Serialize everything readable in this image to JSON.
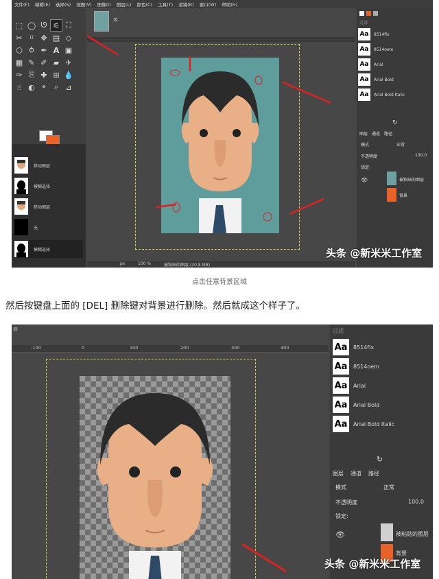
{
  "screenshot1": {
    "menu": [
      "文件(F)",
      "编辑(E)",
      "选择(S)",
      "视图(V)",
      "图像(I)",
      "图层(L)",
      "颜色(C)",
      "工具(T)",
      "滤镜(R)",
      "窗口(W)",
      "帮助(H)"
    ],
    "channels": [
      {
        "label": "移动图层"
      },
      {
        "label": "模糊选择"
      },
      {
        "label": "移动图层"
      },
      {
        "label": "无"
      },
      {
        "label": "模糊选择"
      }
    ],
    "status": {
      "unit": "px",
      "zoom": "100 %",
      "info": "被粘贴的图层 (20.8 MB)"
    },
    "right_panel": {
      "filter_placeholder": "过滤",
      "fonts": [
        "8514fix",
        "8514oem",
        "Arial",
        "Arial Bold",
        "Arial Bold Italic"
      ],
      "tabs": [
        "图层",
        "通道",
        "路径"
      ],
      "mode_label": "模式",
      "mode_value": "正常",
      "opacity_label": "不透明度",
      "opacity_value": "100.0",
      "lock_label": "锁定:",
      "layers": [
        "被粘贴的图层",
        "背景"
      ]
    }
  },
  "caption": "点击任意背景区域",
  "body_text": "然后按键盘上面的 [DEL] 删除键对背景进行删除。然后就成这个样子了。",
  "screenshot2": {
    "ruler_ticks": [
      "-100",
      "0",
      "100",
      "200",
      "300",
      "400"
    ],
    "right_panel": {
      "filter_placeholder": "过滤",
      "fonts": [
        "8514fix",
        "8514oem",
        "Arial",
        "Arial Bold",
        "Arial Bold Italic"
      ],
      "tabs": [
        "图层",
        "通道",
        "路径"
      ],
      "mode_label": "模式",
      "mode_value": "正常",
      "opacity_label": "不透明度",
      "opacity_value": "100.0",
      "lock_label": "锁定:",
      "layers": [
        "被粘贴的图层",
        "背景"
      ]
    }
  },
  "watermark": "头条 @新米米工作室",
  "colors": {
    "accent_orange": "#e9622a",
    "photo_bg": "#5f9c9c",
    "selection": "#d6d14a",
    "arrow": "#e02020"
  }
}
